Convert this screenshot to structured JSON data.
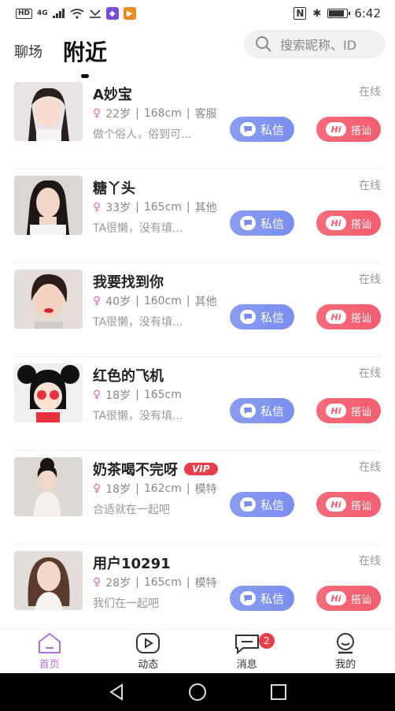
{
  "status": {
    "hd": "HD",
    "net": "4G",
    "time": "6:42"
  },
  "tabs": [
    {
      "label": "聊场"
    },
    {
      "label": "附近"
    }
  ],
  "search": {
    "placeholder": "搜索昵称、ID"
  },
  "users": [
    {
      "name": "A妙宝",
      "status": "在线",
      "age": "22岁",
      "height": "168cm",
      "job": "客服",
      "bio": "做个俗人，俗到可...",
      "avatar": "woman-light",
      "vip": false
    },
    {
      "name": "糖丫头",
      "status": "在线",
      "age": "33岁",
      "height": "165cm",
      "job": "其他",
      "bio": "TA很懒，没有填...",
      "avatar": "woman-long-hair",
      "vip": false
    },
    {
      "name": "我要找到你",
      "status": "在线",
      "age": "40岁",
      "height": "160cm",
      "job": "其他",
      "bio": "TA很懒，没有填...",
      "avatar": "woman-red-lips",
      "vip": false
    },
    {
      "name": "红色的飞机",
      "status": "在线",
      "age": "18岁",
      "height": "165cm",
      "job": "",
      "bio": "TA很懒，没有填...",
      "avatar": "cartoon-girl",
      "vip": false
    },
    {
      "name": "奶茶喝不完呀",
      "status": "在线",
      "age": "18岁",
      "height": "162cm",
      "job": "模特",
      "bio": "合适就在一起吧",
      "avatar": "woman-white-top",
      "vip": true,
      "vip_label": "VIP"
    },
    {
      "name": "用户10291",
      "status": "在线",
      "age": "28岁",
      "height": "165cm",
      "job": "模特",
      "bio": "我们在一起吧",
      "avatar": "woman-brown-hair",
      "vip": false
    }
  ],
  "buttons": {
    "message": "私信",
    "hi": "搭讪",
    "hi_icon": "Hi"
  },
  "nav": [
    {
      "label": "首页",
      "icon": "home-icon",
      "active": true
    },
    {
      "label": "动态",
      "icon": "play-icon",
      "active": false
    },
    {
      "label": "消息",
      "icon": "chat-icon",
      "active": false,
      "badge": "2"
    },
    {
      "label": "我的",
      "icon": "profile-icon",
      "active": false
    }
  ],
  "colors": {
    "accent": "#b36ee0",
    "message_btn": "#7b8ef0",
    "hi_btn": "#f35e6f",
    "vip": "#e83f4a"
  }
}
